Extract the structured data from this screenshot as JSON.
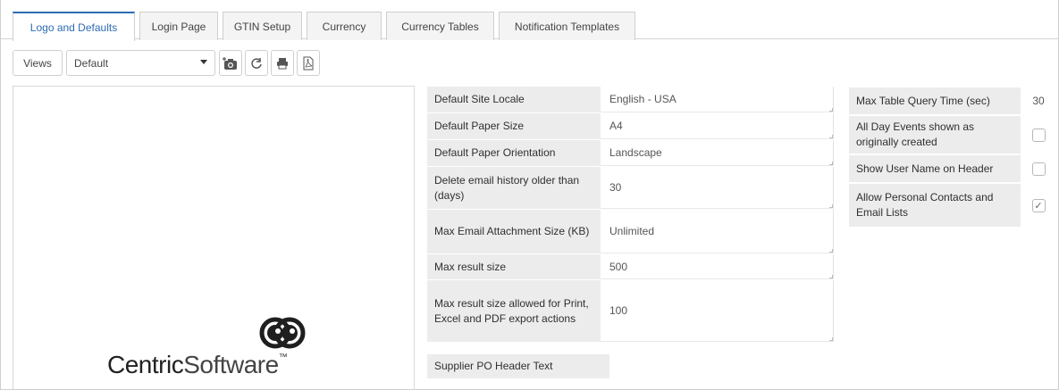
{
  "tabs": [
    {
      "label": "Logo and Defaults",
      "active": true
    },
    {
      "label": "Login Page"
    },
    {
      "label": "GTIN Setup"
    },
    {
      "label": "Currency"
    },
    {
      "label": "Currency Tables"
    },
    {
      "label": "Notification Templates"
    }
  ],
  "toolbar": {
    "views_label": "Views",
    "views_selected": "Default",
    "icons": [
      "snapshot-icon",
      "refresh-icon",
      "print-icon",
      "pdf-icon"
    ]
  },
  "logo": {
    "brand_bold": "Centric",
    "brand_light": "Software",
    "trademark": "™"
  },
  "properties": [
    {
      "label": "Default Site Locale",
      "value": "English - USA"
    },
    {
      "label": "Default Paper Size",
      "value": "A4"
    },
    {
      "label": "Default Paper Orientation",
      "value": "Landscape"
    },
    {
      "label": "Delete email history older than (days)",
      "value": "30"
    },
    {
      "label": "Max Email Attachment Size (KB)",
      "value": "Unlimited"
    },
    {
      "label": "Max result size",
      "value": "500"
    },
    {
      "label": "Max result size allowed for Print, Excel and PDF export actions",
      "value": "100"
    },
    {
      "label": "Supplier PO Header Text",
      "value": ""
    }
  ],
  "settings": [
    {
      "label": "Max Table Query Time (sec)",
      "value": "30"
    },
    {
      "label": "All Day Events shown as originally created",
      "checked": false
    },
    {
      "label": "Show User Name on Header",
      "checked": false
    },
    {
      "label": "Allow Personal Contacts and Email Lists",
      "checked": true
    }
  ],
  "colors": {
    "accent": "#2d6bb3",
    "label_bg": "#ececec"
  }
}
